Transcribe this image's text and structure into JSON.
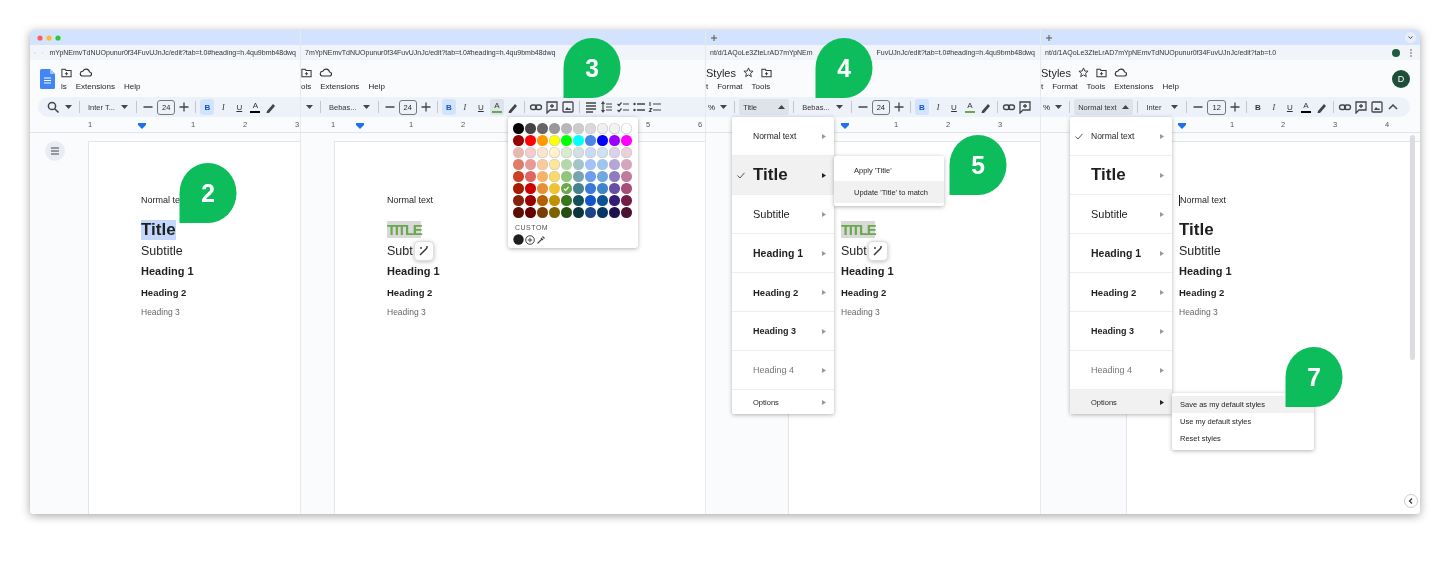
{
  "panels": [
    {
      "tabbar": {
        "traffic_lights": true
      },
      "address": {
        "nav_buttons": true,
        "url": [
          "mYpNEmvTdNUOpunur0f34FuvUJnJc/edit?tab=t.0#heading=h.4qu9bmb48dwq"
        ]
      },
      "header": {
        "logo": true,
        "icons": [
          {
            "kind": "folder"
          },
          {
            "kind": "cloud"
          }
        ],
        "menus": [
          "ls",
          "Extensions",
          "Help"
        ]
      },
      "toolbar": [
        {
          "kind": "search"
        },
        {
          "kind": "caret"
        },
        {
          "kind": "separator"
        },
        {
          "kind": "font",
          "text": "Inter T..."
        },
        {
          "kind": "separator"
        },
        {
          "kind": "minus"
        },
        {
          "kind": "size",
          "text": "24"
        },
        {
          "kind": "plus"
        },
        {
          "kind": "separator"
        },
        {
          "kind": "bold",
          "text": "B",
          "selected": true
        },
        {
          "kind": "italic",
          "text": "I",
          "selected": false
        },
        {
          "kind": "underline",
          "text": "U",
          "selected": false
        },
        {
          "kind": "textcolor",
          "text": "A",
          "color": "#000000",
          "selected": false
        },
        {
          "kind": "highlight"
        }
      ],
      "ruler": [
        "1",
        "1",
        "2",
        "3"
      ],
      "document": {
        "outline_button": true,
        "lines": [
          {
            "kind": "normal",
            "text": "Normal te",
            "selected": false
          },
          {
            "kind": "title",
            "text": "Title",
            "selected": true
          },
          {
            "kind": "subtitle",
            "text": "Subtitle",
            "selected": false
          },
          {
            "kind": "h1",
            "text": "Heading 1",
            "selected": false
          },
          {
            "kind": "h2",
            "text": "Heading 2",
            "selected": false
          },
          {
            "kind": "h3",
            "text": "Heading 3",
            "selected": false
          }
        ]
      }
    },
    {
      "address": {
        "url": [
          "7mYpNEmvTdNUOpunur0f34FuvUJnJc/edit?tab=t.0#heading=h.4qu9bmb48dwq"
        ]
      },
      "header": {
        "icons": [
          {
            "kind": "folder"
          },
          {
            "kind": "cloud"
          }
        ],
        "menus": [
          "ols",
          "Extensions",
          "Help"
        ]
      },
      "toolbar": [
        {
          "kind": "caret"
        },
        {
          "kind": "separator"
        },
        {
          "kind": "font",
          "text": "Bebas..."
        },
        {
          "kind": "separator"
        },
        {
          "kind": "minus"
        },
        {
          "kind": "size",
          "text": "24"
        },
        {
          "kind": "plus"
        },
        {
          "kind": "separator"
        },
        {
          "kind": "bold",
          "text": "B",
          "selected": true
        },
        {
          "kind": "italic",
          "text": "I",
          "selected": false
        },
        {
          "kind": "underline",
          "text": "U",
          "selected": false
        },
        {
          "kind": "textcolor",
          "text": "A",
          "color": "#6aa84f",
          "selected": true
        },
        {
          "kind": "highlight"
        },
        {
          "kind": "separator"
        },
        {
          "kind": "link"
        },
        {
          "kind": "comment"
        },
        {
          "kind": "image"
        },
        {
          "kind": "separator"
        },
        {
          "kind": "align"
        },
        {
          "kind": "spacing"
        },
        {
          "kind": "checklist"
        },
        {
          "kind": "bullets"
        },
        {
          "kind": "numbered"
        }
      ],
      "ruler": [
        "1",
        "1",
        "2",
        "5",
        "6"
      ],
      "palette": {
        "custom_label": "CUSTOM",
        "rows": [
          {
            "swatches": [
              {
                "color": "#000000",
                "selected": false
              },
              {
                "color": "#434343",
                "selected": false
              },
              {
                "color": "#666666",
                "selected": false
              },
              {
                "color": "#999999",
                "selected": false
              },
              {
                "color": "#b7b7b7",
                "selected": false
              },
              {
                "color": "#cccccc",
                "selected": false
              },
              {
                "color": "#d9d9d9",
                "selected": false
              },
              {
                "color": "#efefef",
                "selected": false
              },
              {
                "color": "#f3f3f3",
                "selected": false
              },
              {
                "color": "#ffffff",
                "selected": false
              }
            ]
          },
          {
            "swatches": [
              {
                "color": "#980000",
                "selected": false
              },
              {
                "color": "#ff0000",
                "selected": false
              },
              {
                "color": "#ff9900",
                "selected": false
              },
              {
                "color": "#ffff00",
                "selected": false
              },
              {
                "color": "#00ff00",
                "selected": false
              },
              {
                "color": "#00ffff",
                "selected": false
              },
              {
                "color": "#4a86e8",
                "selected": false
              },
              {
                "color": "#0000ff",
                "selected": false
              },
              {
                "color": "#9900ff",
                "selected": false
              },
              {
                "color": "#ff00ff",
                "selected": false
              }
            ]
          },
          {
            "swatches": [
              {
                "color": "#e6b8af",
                "selected": false
              },
              {
                "color": "#f4cccc",
                "selected": false
              },
              {
                "color": "#fce5cd",
                "selected": false
              },
              {
                "color": "#fff2cc",
                "selected": false
              },
              {
                "color": "#d9ead3",
                "selected": false
              },
              {
                "color": "#d0e0e3",
                "selected": false
              },
              {
                "color": "#c9daf8",
                "selected": false
              },
              {
                "color": "#cfe2f3",
                "selected": false
              },
              {
                "color": "#d9d2e9",
                "selected": false
              },
              {
                "color": "#ead1dc",
                "selected": false
              }
            ]
          },
          {
            "swatches": [
              {
                "color": "#dd7e6b",
                "selected": false
              },
              {
                "color": "#ea9999",
                "selected": false
              },
              {
                "color": "#f9cb9c",
                "selected": false
              },
              {
                "color": "#ffe599",
                "selected": false
              },
              {
                "color": "#b6d7a8",
                "selected": false
              },
              {
                "color": "#a2c4c9",
                "selected": false
              },
              {
                "color": "#a4c2f4",
                "selected": false
              },
              {
                "color": "#9fc5e8",
                "selected": false
              },
              {
                "color": "#b4a7d6",
                "selected": false
              },
              {
                "color": "#d5a6bd",
                "selected": false
              }
            ]
          },
          {
            "swatches": [
              {
                "color": "#cc4125",
                "selected": false
              },
              {
                "color": "#e06666",
                "selected": false
              },
              {
                "color": "#f6b26b",
                "selected": false
              },
              {
                "color": "#ffd966",
                "selected": false
              },
              {
                "color": "#93c47d",
                "selected": false
              },
              {
                "color": "#76a5af",
                "selected": false
              },
              {
                "color": "#6d9eeb",
                "selected": false
              },
              {
                "color": "#6fa8dc",
                "selected": false
              },
              {
                "color": "#8e7cc3",
                "selected": false
              },
              {
                "color": "#c27ba0",
                "selected": false
              }
            ]
          },
          {
            "swatches": [
              {
                "color": "#a61c00",
                "selected": false
              },
              {
                "color": "#cc0000",
                "selected": false
              },
              {
                "color": "#e69138",
                "selected": false
              },
              {
                "color": "#f1c232",
                "selected": false
              },
              {
                "color": "#6aa84f",
                "selected": true
              },
              {
                "color": "#45818e",
                "selected": false
              },
              {
                "color": "#3c78d8",
                "selected": false
              },
              {
                "color": "#3d85c6",
                "selected": false
              },
              {
                "color": "#674ea7",
                "selected": false
              },
              {
                "color": "#a64d79",
                "selected": false
              }
            ]
          },
          {
            "swatches": [
              {
                "color": "#85200c",
                "selected": false
              },
              {
                "color": "#990000",
                "selected": false
              },
              {
                "color": "#b45f06",
                "selected": false
              },
              {
                "color": "#bf9000",
                "selected": false
              },
              {
                "color": "#38761d",
                "selected": false
              },
              {
                "color": "#134f5c",
                "selected": false
              },
              {
                "color": "#1155cc",
                "selected": false
              },
              {
                "color": "#0b5394",
                "selected": false
              },
              {
                "color": "#351c75",
                "selected": false
              },
              {
                "color": "#741b47",
                "selected": false
              }
            ]
          },
          {
            "swatches": [
              {
                "color": "#5b0f00",
                "selected": false
              },
              {
                "color": "#660000",
                "selected": false
              },
              {
                "color": "#783f04",
                "selected": false
              },
              {
                "color": "#7f6000",
                "selected": false
              },
              {
                "color": "#274e13",
                "selected": false
              },
              {
                "color": "#0c343d",
                "selected": false
              },
              {
                "color": "#1c4587",
                "selected": false
              },
              {
                "color": "#073763",
                "selected": false
              },
              {
                "color": "#20124d",
                "selected": false
              },
              {
                "color": "#4c1130",
                "selected": false
              }
            ]
          }
        ]
      },
      "document": {
        "lines": [
          {
            "kind": "normal",
            "text": "Normal text",
            "selected": false
          },
          {
            "kind": "title",
            "text": "TITLE",
            "color": "#6aa84f",
            "selected": true
          },
          {
            "kind": "subtitle",
            "text": "Subt",
            "selected": false,
            "action": true
          },
          {
            "kind": "h1",
            "text": "Heading 1",
            "selected": false
          },
          {
            "kind": "h2",
            "text": "Heading 2",
            "selected": false
          },
          {
            "kind": "h3",
            "text": "Heading 3",
            "selected": false
          }
        ]
      }
    },
    {
      "tabbar": {
        "new_tab": true
      },
      "address": {
        "url": [
          "nt/d/1AQoLe3ZteLrAD7mYpNEm",
          "FuvUJnJc/edit?tab=t.0#heading=h.4qu9bmb48dwq"
        ]
      },
      "header": {
        "title": "Styles",
        "icons": [
          {
            "kind": "star"
          },
          {
            "kind": "folder"
          }
        ],
        "menus": [
          "t",
          "Format",
          "Tools"
        ]
      },
      "toolbar": [
        {
          "kind": "zoom",
          "text": "%"
        },
        {
          "kind": "caret"
        },
        {
          "kind": "separator"
        },
        {
          "kind": "style",
          "text": "Title",
          "expanded": true
        },
        {
          "kind": "separator"
        },
        {
          "kind": "font",
          "text": "Bebas..."
        },
        {
          "kind": "separator"
        },
        {
          "kind": "minus"
        },
        {
          "kind": "size",
          "text": "24"
        },
        {
          "kind": "plus"
        },
        {
          "kind": "separator"
        },
        {
          "kind": "bold",
          "text": "B",
          "selected": true
        },
        {
          "kind": "italic",
          "text": "I",
          "selected": false
        },
        {
          "kind": "underline",
          "text": "U",
          "selected": false
        },
        {
          "kind": "textcolor",
          "text": "A",
          "color": "#6aa84f",
          "selected": false
        },
        {
          "kind": "highlight"
        },
        {
          "kind": "separator"
        },
        {
          "kind": "link"
        },
        {
          "kind": "comment"
        }
      ],
      "ruler": [
        "1",
        "2",
        "3"
      ],
      "style_menu": {
        "items": [
          {
            "kind": "normal",
            "label": "Normal text",
            "checked": false,
            "highlighted": false
          },
          {
            "kind": "title",
            "label": "Title",
            "checked": true,
            "highlighted": true
          },
          {
            "kind": "subtitle",
            "label": "Subtitle",
            "checked": false,
            "highlighted": false
          },
          {
            "kind": "h1",
            "label": "Heading 1",
            "checked": false,
            "highlighted": false
          },
          {
            "kind": "h2",
            "label": "Heading 2",
            "checked": false,
            "highlighted": false
          },
          {
            "kind": "h3",
            "label": "Heading 3",
            "checked": false,
            "highlighted": false
          },
          {
            "kind": "h4",
            "label": "Heading 4",
            "checked": false,
            "highlighted": false
          },
          {
            "kind": "options",
            "label": "Options",
            "checked": false,
            "highlighted": false
          }
        ],
        "submenu": {
          "items": [
            {
              "label": "Apply 'Title'",
              "highlighted": false
            },
            {
              "label": "Update 'Title' to match",
              "highlighted": true
            }
          ]
        }
      },
      "document": {
        "lines": [
          {
            "kind": "title",
            "text": "TITLE",
            "color": "#6aa84f",
            "selected": true
          },
          {
            "kind": "subtitle",
            "text": "Subt",
            "selected": false,
            "action": true
          },
          {
            "kind": "h1",
            "text": "Heading 1",
            "selected": false
          },
          {
            "kind": "h2",
            "text": "Heading 2",
            "selected": false
          },
          {
            "kind": "h3",
            "text": "Heading 3",
            "selected": false
          }
        ]
      }
    },
    {
      "tabbar": {
        "new_tab": true,
        "menu_button": true
      },
      "address": {
        "url": [
          "nt/d/1AQoLe3ZteLrAD7mYpNEmvTdNUOpunur0f34FuvUJnJc/edit?tab=t.0"
        ],
        "profile": true
      },
      "header": {
        "title": "Styles",
        "icons": [
          {
            "kind": "star"
          },
          {
            "kind": "folder"
          },
          {
            "kind": "cloud"
          }
        ],
        "menus": [
          "t",
          "Format",
          "Tools",
          "Extensions",
          "Help"
        ],
        "avatar": "D"
      },
      "toolbar": [
        {
          "kind": "zoom",
          "text": "%"
        },
        {
          "kind": "caret"
        },
        {
          "kind": "separator"
        },
        {
          "kind": "style",
          "text": "Normal text",
          "expanded": true
        },
        {
          "kind": "separator"
        },
        {
          "kind": "font",
          "text": "Inter"
        },
        {
          "kind": "separator"
        },
        {
          "kind": "minus"
        },
        {
          "kind": "size",
          "text": "12"
        },
        {
          "kind": "plus"
        },
        {
          "kind": "separator"
        },
        {
          "kind": "bold",
          "text": "B",
          "selected": false
        },
        {
          "kind": "italic",
          "text": "I",
          "selected": false
        },
        {
          "kind": "underline",
          "text": "U",
          "selected": false
        },
        {
          "kind": "textcolor",
          "text": "A",
          "color": "#000000",
          "selected": false
        },
        {
          "kind": "highlight"
        },
        {
          "kind": "separator"
        },
        {
          "kind": "link"
        },
        {
          "kind": "comment"
        },
        {
          "kind": "image"
        },
        {
          "kind": "collapse"
        }
      ],
      "ruler": [
        "1",
        "2",
        "3",
        "4"
      ],
      "style_menu": {
        "items": [
          {
            "kind": "normal",
            "label": "Normal text",
            "checked": true,
            "highlighted": false
          },
          {
            "kind": "title",
            "label": "Title",
            "checked": false,
            "highlighted": false
          },
          {
            "kind": "subtitle",
            "label": "Subtitle",
            "checked": false,
            "highlighted": false
          },
          {
            "kind": "h1",
            "label": "Heading 1",
            "checked": false,
            "highlighted": false
          },
          {
            "kind": "h2",
            "label": "Heading 2",
            "checked": false,
            "highlighted": false
          },
          {
            "kind": "h3",
            "label": "Heading 3",
            "checked": false,
            "highlighted": false
          },
          {
            "kind": "h4",
            "label": "Heading 4",
            "checked": false,
            "highlighted": false
          },
          {
            "kind": "options",
            "label": "Options",
            "checked": false,
            "highlighted": true
          }
        ],
        "submenu": {
          "items": [
            {
              "label": "Save as my default styles",
              "highlighted": true
            },
            {
              "label": "Use my default styles",
              "highlighted": false
            },
            {
              "label": "Reset styles",
              "highlighted": false
            }
          ]
        }
      },
      "document": {
        "scrollbar": true,
        "collapse_button": true,
        "lines": [
          {
            "kind": "normal",
            "text": "Normal text",
            "selected": false,
            "cursor": true
          },
          {
            "kind": "title",
            "text": "Title",
            "selected": false
          },
          {
            "kind": "subtitle",
            "text": "Subtitle",
            "selected": false
          },
          {
            "kind": "h1",
            "text": "Heading 1",
            "selected": false
          },
          {
            "kind": "h2",
            "text": "Heading 2",
            "selected": false
          },
          {
            "kind": "h3",
            "text": "Heading 3",
            "selected": false
          }
        ]
      }
    }
  ],
  "callouts": [
    {
      "number": "2"
    },
    {
      "number": "3"
    },
    {
      "number": "4"
    },
    {
      "number": "5"
    },
    {
      "number": "7"
    }
  ]
}
